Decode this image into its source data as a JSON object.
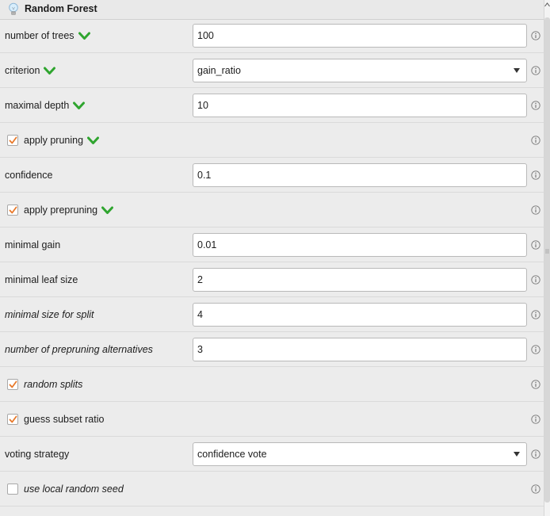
{
  "header": {
    "title": "Random Forest",
    "icon": "lightbulb-icon"
  },
  "params": [
    {
      "id": "number-of-trees",
      "label": "number of trees",
      "type": "text",
      "value": "100",
      "expert_marker": true,
      "italic": false
    },
    {
      "id": "criterion",
      "label": "criterion",
      "type": "select",
      "value": "gain_ratio",
      "expert_marker": true,
      "italic": false
    },
    {
      "id": "maximal-depth",
      "label": "maximal depth",
      "type": "text",
      "value": "10",
      "expert_marker": true,
      "italic": false
    },
    {
      "id": "apply-pruning",
      "label": "apply pruning",
      "type": "checkbox",
      "checked": true,
      "expert_marker": true,
      "italic": false
    },
    {
      "id": "confidence",
      "label": "confidence",
      "type": "text",
      "value": "0.1",
      "expert_marker": false,
      "italic": false
    },
    {
      "id": "apply-prepruning",
      "label": "apply prepruning",
      "type": "checkbox",
      "checked": true,
      "expert_marker": true,
      "italic": false
    },
    {
      "id": "minimal-gain",
      "label": "minimal gain",
      "type": "text",
      "value": "0.01",
      "expert_marker": false,
      "italic": false
    },
    {
      "id": "minimal-leaf-size",
      "label": "minimal leaf size",
      "type": "text",
      "value": "2",
      "expert_marker": false,
      "italic": false
    },
    {
      "id": "minimal-size-for-split",
      "label": "minimal size for split",
      "type": "text",
      "value": "4",
      "expert_marker": false,
      "italic": true
    },
    {
      "id": "number-of-prepruning-alternatives",
      "label": "number of prepruning alternatives",
      "type": "text",
      "value": "3",
      "expert_marker": false,
      "italic": true
    },
    {
      "id": "random-splits",
      "label": "random splits",
      "type": "checkbox",
      "checked": true,
      "expert_marker": false,
      "italic": true
    },
    {
      "id": "guess-subset-ratio",
      "label": "guess subset ratio",
      "type": "checkbox",
      "checked": true,
      "expert_marker": false,
      "italic": false
    },
    {
      "id": "voting-strategy",
      "label": "voting strategy",
      "type": "select",
      "value": "confidence vote",
      "expert_marker": false,
      "italic": false
    },
    {
      "id": "use-local-random-seed",
      "label": "use local random seed",
      "type": "checkbox",
      "checked": false,
      "expert_marker": false,
      "italic": true
    }
  ],
  "colors": {
    "expert_marker": "#2fa52f",
    "checkmark": "#e8792a",
    "info": "#7a7a7a"
  }
}
